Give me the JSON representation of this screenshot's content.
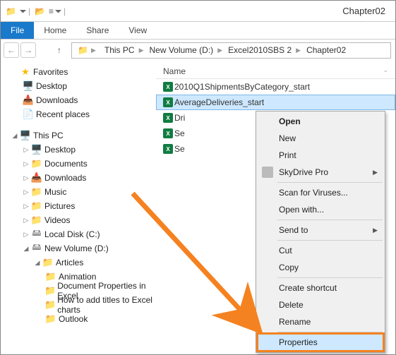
{
  "title": "Chapter02",
  "ribbon": {
    "file": "File",
    "tabs": [
      "Home",
      "Share",
      "View"
    ]
  },
  "breadcrumb": [
    "This PC",
    "New Volume (D:)",
    "Excel2010SBS 2",
    "Chapter02"
  ],
  "favorites": {
    "header": "Favorites",
    "items": [
      "Desktop",
      "Downloads",
      "Recent places"
    ]
  },
  "thispc": {
    "header": "This PC",
    "items": [
      "Desktop",
      "Documents",
      "Downloads",
      "Music",
      "Pictures",
      "Videos",
      "Local Disk (C:)",
      "New Volume (D:)"
    ],
    "articles": {
      "header": "Articles",
      "items": [
        "Animation",
        "Document Properties in Excel",
        "How to add titles to Excel charts",
        "Outlook"
      ]
    }
  },
  "columns": {
    "name": "Name"
  },
  "files": [
    {
      "name": "2010Q1ShipmentsByCategory_start"
    },
    {
      "name": "AverageDeliveries_start",
      "selected": true
    },
    {
      "name": "Dri"
    },
    {
      "name": "Se"
    },
    {
      "name": "Se"
    }
  ],
  "context_menu": {
    "open": "Open",
    "new": "New",
    "print": "Print",
    "skydrive": "SkyDrive Pro",
    "scan": "Scan for Viruses...",
    "openwith": "Open with...",
    "sendto": "Send to",
    "cut": "Cut",
    "copy": "Copy",
    "shortcut": "Create shortcut",
    "delete": "Delete",
    "rename": "Rename",
    "properties": "Properties"
  }
}
